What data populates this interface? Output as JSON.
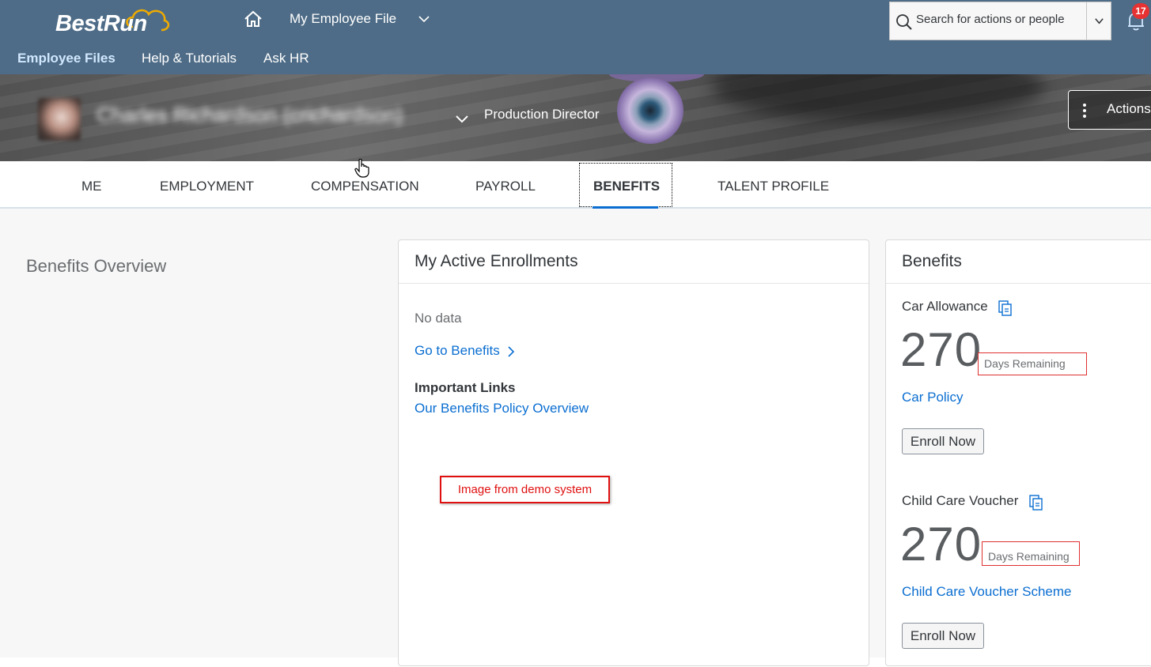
{
  "shell": {
    "logo_text": "BestRun",
    "app_title": "My Employee File",
    "search_placeholder": "Search for actions or people",
    "notification_count": "17",
    "nav": [
      "Employee Files",
      "Help & Tutorials",
      "Ask HR"
    ]
  },
  "profile": {
    "name": "Charles Richardson (crichardson)",
    "job_title": "Production Director",
    "actions_label": "Actions"
  },
  "tabs": [
    "ME",
    "EMPLOYMENT",
    "COMPENSATION",
    "PAYROLL",
    "BENEFITS",
    "TALENT PROFILE"
  ],
  "active_tab": "BENEFITS",
  "main": {
    "section_title": "Benefits Overview",
    "enrollments": {
      "title": "My Active Enrollments",
      "no_data": "No data",
      "go_link": "Go to Benefits",
      "links_heading": "Important Links",
      "policy_link": "Our Benefits Policy Overview",
      "demo_note": "Image from demo system"
    },
    "benefits": {
      "title": "Benefits",
      "items": [
        {
          "label": "Car Allowance",
          "value": "270",
          "unit": "Days Remaining",
          "link": "Car Policy",
          "button": "Enroll Now"
        },
        {
          "label": "Child Care Voucher",
          "value": "270",
          "unit": "Days Remaining",
          "link": "Child Care Voucher Scheme",
          "button": "Enroll Now"
        }
      ]
    }
  },
  "colors": {
    "shell_bg": "#4e6c87",
    "link": "#0a6ed1",
    "badge": "#e63232",
    "highlight_border": "#e01010"
  }
}
